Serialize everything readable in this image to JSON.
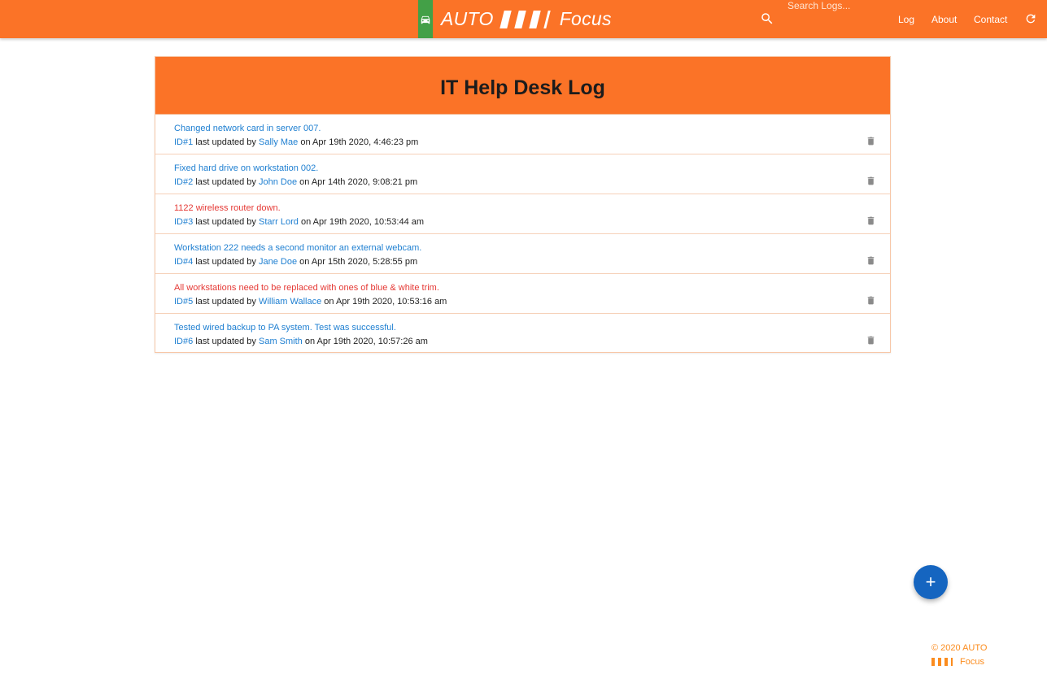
{
  "navbar": {
    "brand_left": "AUTO",
    "brand_right": "Focus",
    "search_placeholder": "Search Logs...",
    "links": [
      "Log",
      "About",
      "Contact"
    ],
    "colors": {
      "bar": "#fb7327",
      "car_badge": "#43a047"
    },
    "icons": [
      "car-icon",
      "search-icon",
      "refresh-icon"
    ]
  },
  "page": {
    "title": "IT Help Desk Log"
  },
  "logs": [
    {
      "message": "Changed network card in server 007.",
      "attention": false,
      "id": "ID#1",
      "meta_prefix": "last updated by",
      "tech": "Sally Mae",
      "meta_on": "on Apr 19th 2020, 4:46:23 pm"
    },
    {
      "message": "Fixed hard drive on workstation 002.",
      "attention": false,
      "id": "ID#2",
      "meta_prefix": "last updated by",
      "tech": "John Doe",
      "meta_on": "on Apr 14th 2020, 9:08:21 pm"
    },
    {
      "message": "1122 wireless router down.",
      "attention": true,
      "id": "ID#3",
      "meta_prefix": "last updated by",
      "tech": "Starr Lord",
      "meta_on": "on Apr 19th 2020, 10:53:44 am"
    },
    {
      "message": "Workstation 222 needs a second monitor an external webcam.",
      "attention": false,
      "id": "ID#4",
      "meta_prefix": "last updated by",
      "tech": "Jane Doe",
      "meta_on": "on Apr 15th 2020, 5:28:55 pm"
    },
    {
      "message": "All workstations need to be replaced with ones of blue & white trim.",
      "attention": true,
      "id": "ID#5",
      "meta_prefix": "last updated by",
      "tech": "William Wallace",
      "meta_on": "on Apr 19th 2020, 10:53:16 am"
    },
    {
      "message": "Tested wired backup to PA system. Test was successful.",
      "attention": false,
      "id": "ID#6",
      "meta_prefix": "last updated by",
      "tech": "Sam Smith",
      "meta_on": "on Apr 19th 2020, 10:57:26 am"
    }
  ],
  "fab": {
    "label": "+",
    "color": "#1565c0"
  },
  "footer": {
    "line1": "© 2020 AUTO",
    "line2": "Focus",
    "color": "#fb8c1e"
  }
}
